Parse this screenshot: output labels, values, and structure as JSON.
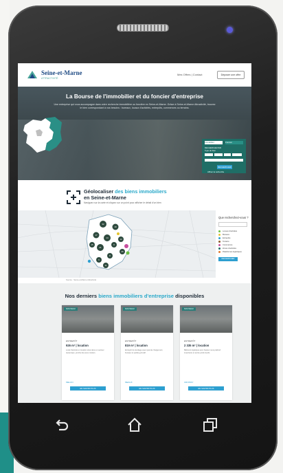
{
  "site": {
    "logo_text": "Seine-et-Marne",
    "logo_sub": "ATTRACTIVITÉ",
    "nav_links": "Mes Offres | Contact",
    "nav_button": "Déposer une offre"
  },
  "hero": {
    "title": "La Bourse de l'immobilier et du foncier d'entreprise",
    "text": "Une entreprise qui vous accompagne dans votre recherche immobilière ou foncière en Seine-et-Marne. Grâce à Seine-et-Marne Attractivité, trouvez le bien correspondant à vos besoins : bureaux, locaux d'activités, entrepôts, commerces ou terrains.",
    "tabs": [
      "Immobilier",
      "Foncier"
    ],
    "search_label": "RECHERCHE PAR",
    "checkbox_label": "Type de bien",
    "search_button": "RECHERCHER",
    "search_link": "Affiner la recherche"
  },
  "geo": {
    "title_prefix": "Géolocaliser",
    "title_accent": "des biens immobiliers",
    "title_suffix": "en Seine-et-Marne",
    "subtitle": "Naviguez sur la carte et cliquez sur un point pour afficher le détail d'un bien",
    "map_note": "Source : Seine-et-Marne Attractivité",
    "map_clusters": [
      "32",
      "19",
      "17",
      "14",
      "21",
      "9",
      "12",
      "8",
      "6",
      "15",
      "26",
      "11"
    ]
  },
  "side": {
    "title": "Que recherchez-vous ?",
    "legend": [
      {
        "label": "Locaux d'activités",
        "color": "#6cbf45"
      },
      {
        "label": "Bureaux",
        "color": "#e4c430"
      },
      {
        "label": "Entrepôts",
        "color": "#2d9fd0"
      },
      {
        "label": "Terrains",
        "color": "#8a5a2b"
      },
      {
        "label": "Commerces",
        "color": "#c64f9e"
      },
      {
        "label": "Zones d'activités",
        "color": "#1f6e66"
      },
      {
        "label": "Plateformes logistiques",
        "color": "#e07a2f"
      }
    ],
    "button": "RECHERCHER"
  },
  "listings": {
    "title_prefix": "Nos derniers",
    "title_accent": "biens immobiliers d'entreprise",
    "title_suffix": "disponibles",
    "cards": [
      {
        "badge": "NOUVEAU",
        "type": "ENTREPÔT",
        "size": "926 m² | location",
        "desc": "Local d'activité en location situé dans un secteur dynamique, proche des axes routiers.",
        "location": "MELUN",
        "button": "EN SAVOIR PLUS"
      },
      {
        "badge": "NOUVEAU",
        "type": "ENTREPÔT",
        "size": "819 m² | location",
        "desc": "Entrepôt de stockage avec quai de chargement, bureaux et parking privatif.",
        "location": "MEAUX",
        "button": "EN SAVOIR PLUS"
      },
      {
        "badge": "NOUVEAU",
        "type": "ENTREPÔT",
        "size": "2 335 m² | location",
        "desc": "Bâtiment logistique avec hauteur sous plafond importante et accès poids lourds.",
        "location": "CROISSY",
        "button": "EN SAVOIR PLUS"
      }
    ]
  },
  "nav_buttons": [
    "back-icon",
    "home-icon",
    "recent-apps-icon"
  ]
}
